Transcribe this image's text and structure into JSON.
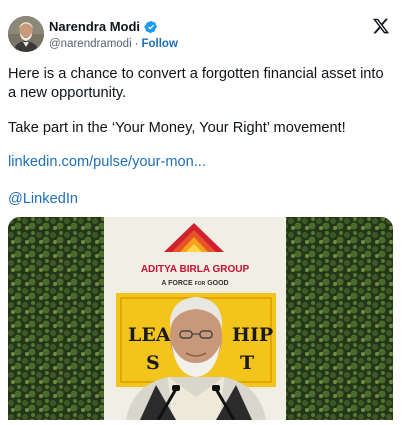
{
  "author": {
    "display_name": "Narendra Modi",
    "handle": "@narendramodi",
    "separator": "·",
    "follow_label": "Follow"
  },
  "tweet": {
    "paragraph_1": "Here is a chance to convert a forgotten financial asset into a new opportunity.",
    "paragraph_2": "Take part in the ‘Your Money, Your Right’ movement!",
    "link_url_text": "linkedin.com/pulse/your-mon...",
    "mention": "@LinkedIn"
  },
  "media": {
    "banner_org": "ADITYA BIRLA GROUP",
    "banner_tagline_1": "A ",
    "banner_tagline_force": "FORCE",
    "banner_tagline_for": "FOR",
    "banner_tagline_good": "GOOD",
    "sign_line_1": "LEA",
    "sign_line_1b": "HIP",
    "sign_line_2": "S",
    "sign_line_2b": "T"
  },
  "colors": {
    "verified": "#1d9bf0",
    "link": "#1d6fb8",
    "banner_red": "#c8102e",
    "sign_yellow": "#f2c41c"
  },
  "icons": {
    "verified": "verified-badge-icon",
    "platform": "x-logo-icon"
  }
}
